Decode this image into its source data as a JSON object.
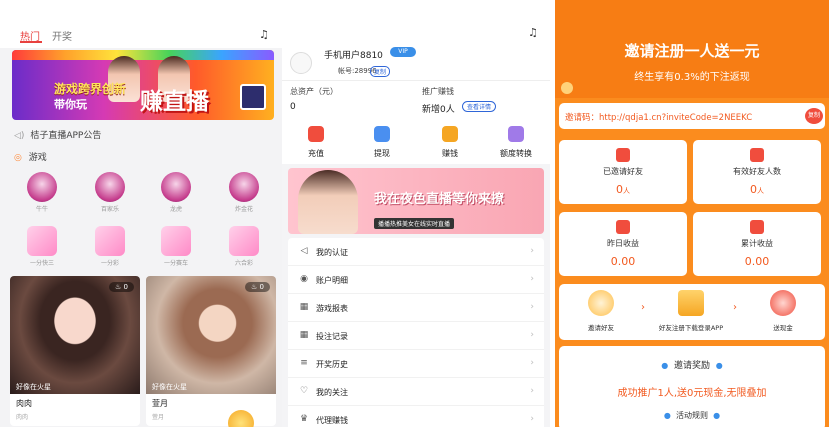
{
  "left": {
    "tabs": [
      "热门",
      "开奖"
    ],
    "banner": {
      "line1": "游戏跨界创新",
      "line2": "带你玩",
      "big": "赚直播"
    },
    "notice": "桔子直播APP公告",
    "section_games": "游戏",
    "games": [
      {
        "name": "牛牛",
        "style": "round"
      },
      {
        "name": "百家乐",
        "style": "round"
      },
      {
        "name": "龙虎",
        "style": "round"
      },
      {
        "name": "炸金花",
        "style": "round"
      },
      {
        "name": "一分快三",
        "style": "pink"
      },
      {
        "name": "一分彩",
        "style": "pink"
      },
      {
        "name": "一分赛车",
        "style": "pink"
      },
      {
        "name": "六合彩",
        "style": "pink"
      }
    ],
    "cards": [
      {
        "live": "0",
        "caption": "好像在火星",
        "name": "肉肉",
        "sub": "肉肉"
      },
      {
        "live": "0",
        "caption": "好像在火星",
        "name": "萱月",
        "sub": "萱月"
      }
    ]
  },
  "middle": {
    "username": "手机用户8810",
    "vip": "VIP",
    "account": "帐号:28996",
    "copy": "复制",
    "assets_label": "总资产（元）",
    "assets_value": "0",
    "promo_label": "推广赚钱",
    "promo_value": "新增0人",
    "detail_btn": "查看详情",
    "actions": [
      {
        "label": "充值",
        "color": "#f04d3d"
      },
      {
        "label": "提现",
        "color": "#4a8ff0"
      },
      {
        "label": "赚钱",
        "color": "#f5a623"
      },
      {
        "label": "额度转换",
        "color": "#a07ae8"
      }
    ],
    "banner_text": "我在夜色直播等你来撩",
    "banner_sub": "播播热推美女在线实时直播",
    "menu": [
      {
        "label": "我的认证",
        "icon": "◁"
      },
      {
        "label": "账户明细",
        "icon": "◉"
      },
      {
        "label": "游戏报表",
        "icon": "▦"
      },
      {
        "label": "投注记录",
        "icon": "▦"
      },
      {
        "label": "开奖历史",
        "icon": "≡"
      },
      {
        "label": "我的关注",
        "icon": "♡"
      },
      {
        "label": "代理赚钱",
        "icon": "♛"
      }
    ]
  },
  "right": {
    "title": "邀请注册一人送一元",
    "subtitle": "终生享有0.3%的下注返现",
    "invite_code": "邀请码：http://qdja1.cn?inviteCode=2NEEKC",
    "copy": "复制",
    "stats": [
      {
        "label": "已邀请好友",
        "value": "0",
        "unit": "人"
      },
      {
        "label": "有效好友人数",
        "value": "0",
        "unit": "人"
      },
      {
        "label": "昨日收益",
        "value": "0.00",
        "unit": ""
      },
      {
        "label": "累计收益",
        "value": "0.00",
        "unit": ""
      }
    ],
    "flow": [
      "邀请好友",
      "好友注册下载登录APP",
      "送现金"
    ],
    "reward_title": "邀请奖励",
    "reward_desc": "成功推广1人,送0元现金,无限叠加",
    "rules_title": "活动规则"
  },
  "colors": {
    "accent": "#fb8c1e",
    "red": "#f25a20",
    "pink": "#e8413f"
  }
}
